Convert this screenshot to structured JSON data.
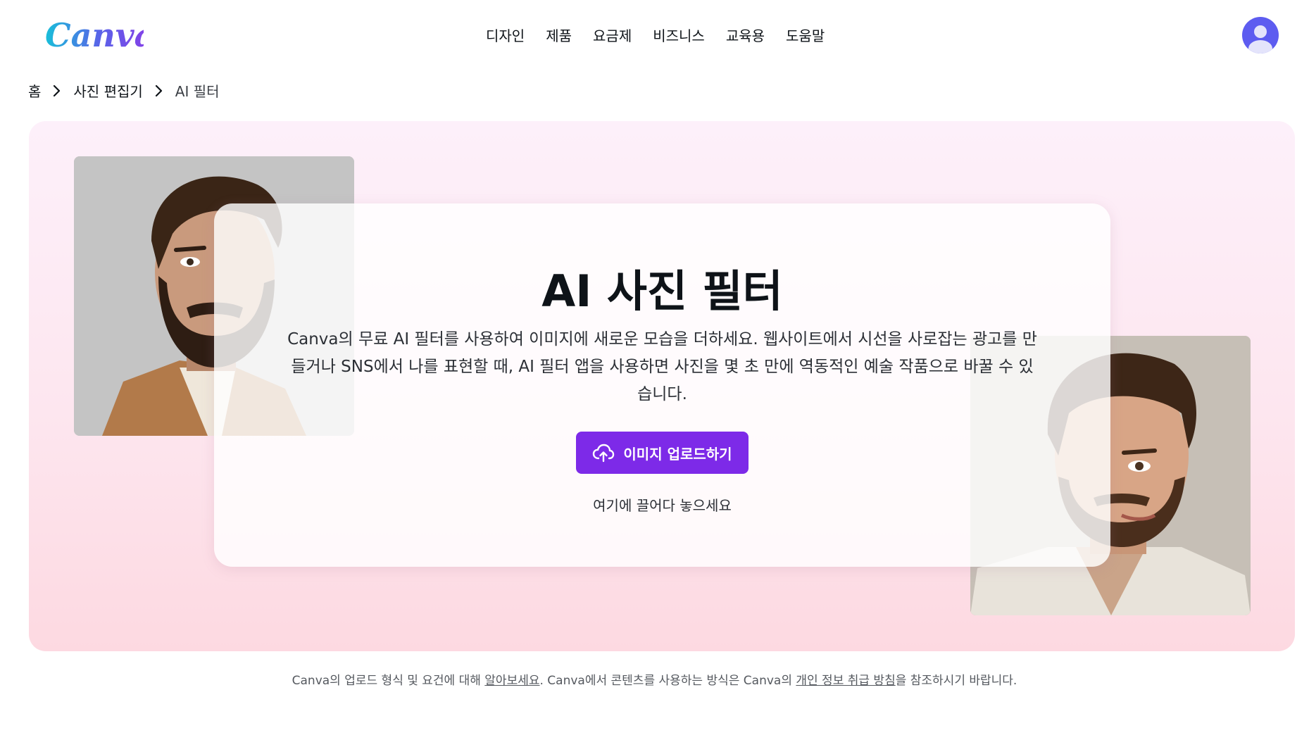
{
  "header": {
    "logo_text": "Canva",
    "nav": [
      "디자인",
      "제품",
      "요금제",
      "비즈니스",
      "교육용",
      "도움말"
    ]
  },
  "breadcrumb": [
    "홈",
    "사진 편집기",
    "AI 필터"
  ],
  "hero": {
    "title": "AI 사진 필터",
    "description": "Canva의 무료 AI 필터를 사용하여 이미지에 새로운 모습을 더하세요. 웹사이트에서 시선을 사로잡는 광고를 만들거나 SNS에서 나를 표현할 때, AI 필터 앱을 사용하면 사진을 몇 초 만에 역동적인 예술 작품으로 바꿀 수 있습니다.",
    "upload_button": "이미지 업로드하기",
    "drop_hint": "여기에 끌어다 놓으세요",
    "upload_icon": "cloud-upload-icon"
  },
  "footer_note": {
    "part1": "Canva의 업로드 형식 및 요건에 대해 ",
    "link1": "알아보세요",
    "part2": ". Canva에서 콘텐츠를 사용하는 방식은 Canva의 ",
    "link2": "개인 정보 취급 방침",
    "part3": "을 참조하시기 바랍니다."
  },
  "colors": {
    "accent": "#7d2ae8",
    "avatar": "#5d5cf0",
    "hero_bg_top": "#fdf0fa",
    "hero_bg_bottom": "#fdd9e1"
  }
}
